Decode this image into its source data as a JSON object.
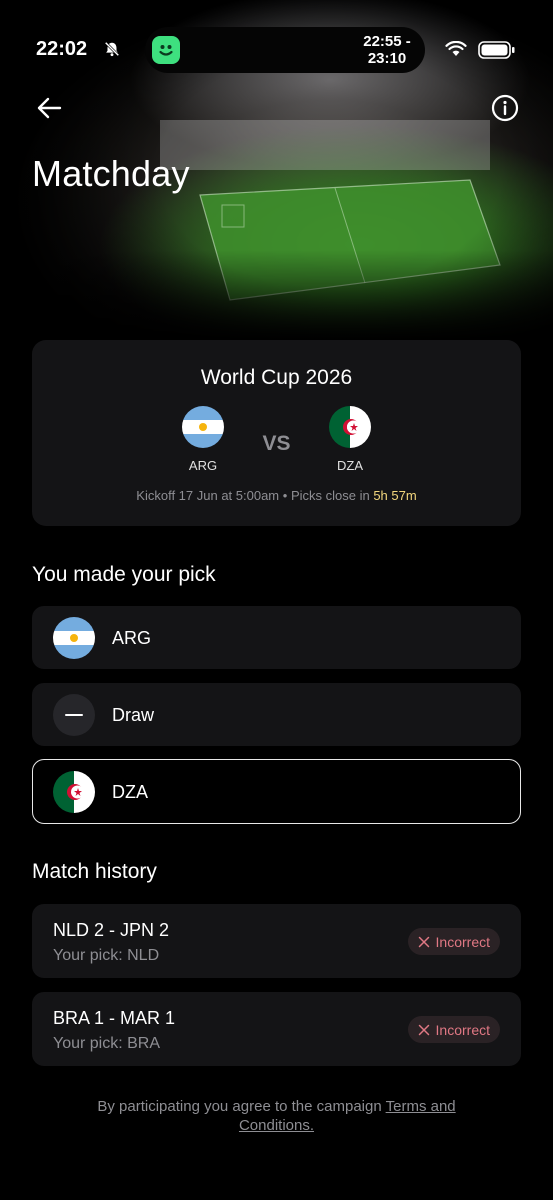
{
  "status_bar": {
    "time": "22:02",
    "activity_time_start": "22:55 -",
    "activity_time_end": "23:10"
  },
  "header": {
    "title": "Matchday",
    "back_icon": "arrow-left-icon",
    "info_icon": "info-icon"
  },
  "match": {
    "competition": "World Cup 2026",
    "home": {
      "code": "ARG",
      "flag": "argentina-flag"
    },
    "away": {
      "code": "DZA",
      "flag": "algeria-flag"
    },
    "vs_label": "VS",
    "kickoff_text": "Kickoff 17 Jun at 5:00am",
    "separator": "•",
    "picks_close_text": "Picks close in",
    "countdown": "5h 57m"
  },
  "picks": {
    "title": "You made your pick",
    "options": [
      {
        "label": "ARG",
        "selected": false
      },
      {
        "label": "Draw",
        "selected": false
      },
      {
        "label": "DZA",
        "selected": true
      }
    ]
  },
  "history": {
    "title": "Match history",
    "items": [
      {
        "score": "NLD 2 - JPN 2",
        "pick": "Your pick: NLD",
        "result": "Incorrect"
      },
      {
        "score": "BRA 1 - MAR 1",
        "pick": "Your pick: BRA",
        "result": "Incorrect"
      }
    ]
  },
  "footer": {
    "text": "By participating you agree to the campaign",
    "link_part1": "Terms and",
    "link_part2": "Conditions."
  },
  "colors": {
    "countdown": "#f3d77d",
    "incorrect": "#e07884",
    "card": "#141416"
  }
}
